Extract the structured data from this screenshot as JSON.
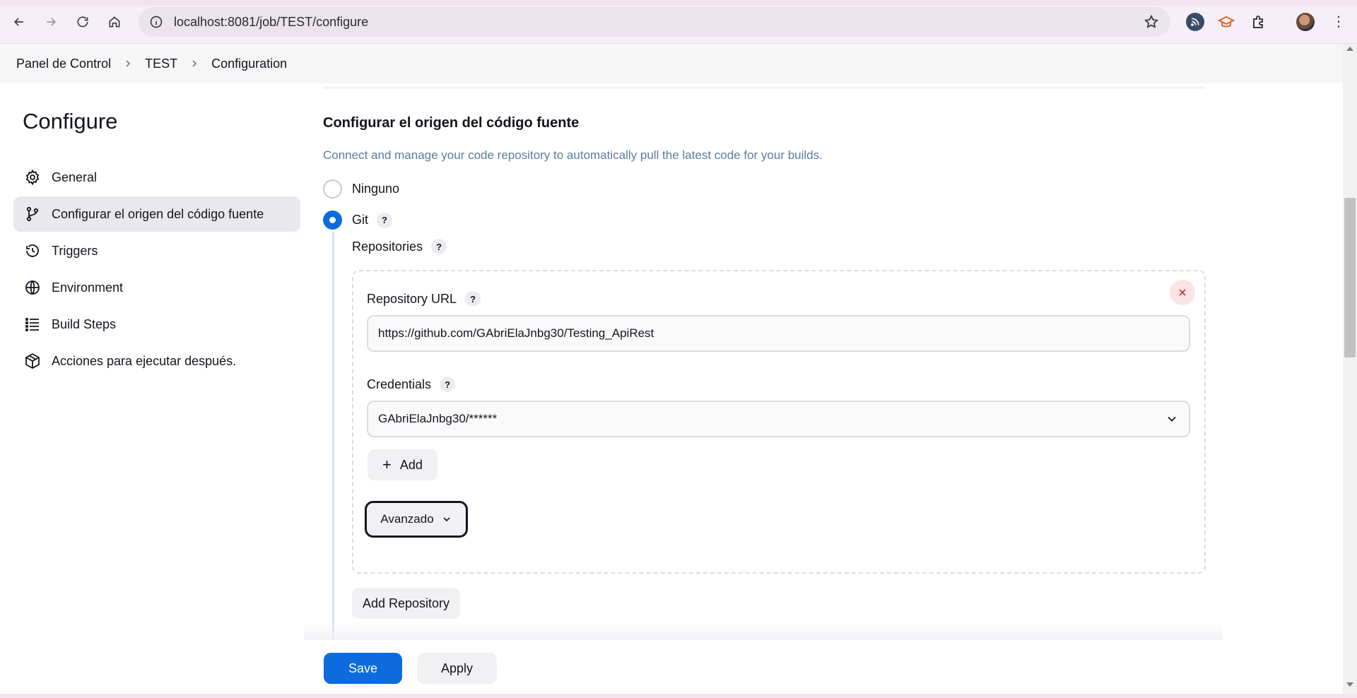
{
  "browser": {
    "url": "localhost:8081/job/TEST/configure"
  },
  "breadcrumb": {
    "items": [
      "Panel de Control",
      "TEST",
      "Configuration"
    ]
  },
  "sidebar": {
    "title": "Configure",
    "items": [
      {
        "label": "General",
        "icon": "gear-icon"
      },
      {
        "label": "Configurar el origen del código fuente",
        "icon": "branch-icon",
        "active": true
      },
      {
        "label": "Triggers",
        "icon": "clock-icon"
      },
      {
        "label": "Environment",
        "icon": "globe-icon"
      },
      {
        "label": "Build Steps",
        "icon": "list-icon"
      },
      {
        "label": "Acciones para ejecutar después.",
        "icon": "package-icon"
      }
    ]
  },
  "scm": {
    "title": "Configurar el origen del código fuente",
    "description": "Connect and manage your code repository to automatically pull the latest code for your builds.",
    "options": [
      {
        "label": "Ninguno",
        "checked": false
      },
      {
        "label": "Git",
        "checked": true
      }
    ],
    "help_glyph": "?",
    "repositories_label": "Repositories",
    "repository_url_label": "Repository URL",
    "repository_url_value": "https://github.com/GAbriElaJnbg30/Testing_ApiRest",
    "credentials_label": "Credentials",
    "credentials_value": "GAbriElaJnbg30/******",
    "add_label": "Add",
    "advanced_label": "Avanzado",
    "add_repository_label": "Add Repository"
  },
  "actions": {
    "save_label": "Save",
    "apply_label": "Apply"
  },
  "colors": {
    "primary": "#0b6bdf",
    "description_text": "#5a7c9c",
    "danger": "#e0263a"
  }
}
